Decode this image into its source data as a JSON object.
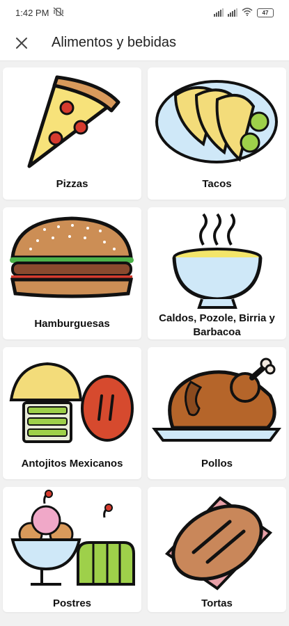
{
  "status": {
    "time": "1:42 PM",
    "battery": "47"
  },
  "header": {
    "title": "Alimentos y bebidas"
  },
  "categories": [
    {
      "label": "Pizzas",
      "icon": "pizza-icon"
    },
    {
      "label": "Tacos",
      "icon": "tacos-icon"
    },
    {
      "label": "Hamburguesas",
      "icon": "burger-icon"
    },
    {
      "label": "Caldos, Pozole, Birria y Barbacoa",
      "icon": "soup-bowl-icon"
    },
    {
      "label": "Antojitos Mexicanos",
      "icon": "antojitos-icon"
    },
    {
      "label": "Pollos",
      "icon": "roast-chicken-icon"
    },
    {
      "label": "Postres",
      "icon": "desserts-icon"
    },
    {
      "label": "Tortas",
      "icon": "torta-icon"
    }
  ]
}
